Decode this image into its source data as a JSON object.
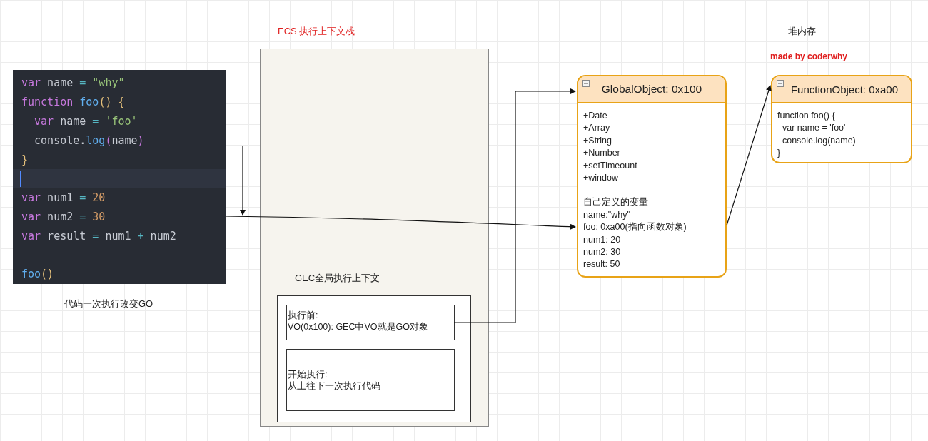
{
  "ecs_title": "ECS 执行上下文栈",
  "heap_title": "堆内存",
  "credit": "made by coderwhy",
  "code_editor": {
    "lines": [
      {
        "current": false,
        "tokens": [
          {
            "text": "var",
            "kind": "kw"
          },
          {
            "text": " name ",
            "kind": "id"
          },
          {
            "text": "=",
            "kind": "op"
          },
          {
            "text": " \"why\"",
            "kind": "str"
          }
        ]
      },
      {
        "current": false,
        "tokens": [
          {
            "text": "function",
            "kind": "kw"
          },
          {
            "text": " foo",
            "kind": "fn"
          },
          {
            "text": "()",
            "kind": "paren"
          },
          {
            "text": " {",
            "kind": "paren"
          }
        ]
      },
      {
        "current": false,
        "tokens": [
          {
            "text": "  var",
            "kind": "kw"
          },
          {
            "text": " name ",
            "kind": "id"
          },
          {
            "text": "=",
            "kind": "op"
          },
          {
            "text": " 'foo'",
            "kind": "str"
          }
        ]
      },
      {
        "current": false,
        "tokens": [
          {
            "text": "  console.",
            "kind": "id"
          },
          {
            "text": "log",
            "kind": "fn"
          },
          {
            "text": "(",
            "kind": "paren2"
          },
          {
            "text": "name",
            "kind": "id"
          },
          {
            "text": ")",
            "kind": "paren2"
          }
        ]
      },
      {
        "current": false,
        "tokens": [
          {
            "text": "}",
            "kind": "paren"
          }
        ]
      },
      {
        "current": true
      },
      {
        "current": false,
        "tokens": [
          {
            "text": "var",
            "kind": "kw"
          },
          {
            "text": " num1 ",
            "kind": "id"
          },
          {
            "text": "=",
            "kind": "op"
          },
          {
            "text": " 20",
            "kind": "num"
          }
        ]
      },
      {
        "current": false,
        "tokens": [
          {
            "text": "var",
            "kind": "kw"
          },
          {
            "text": " num2 ",
            "kind": "id"
          },
          {
            "text": "=",
            "kind": "op"
          },
          {
            "text": " 30",
            "kind": "num"
          }
        ]
      },
      {
        "current": false,
        "tokens": [
          {
            "text": "var",
            "kind": "kw"
          },
          {
            "text": " result ",
            "kind": "id"
          },
          {
            "text": "=",
            "kind": "op"
          },
          {
            "text": " num1 ",
            "kind": "id"
          },
          {
            "text": "+",
            "kind": "op"
          },
          {
            "text": " num2",
            "kind": "id"
          }
        ]
      },
      {
        "current": false,
        "tokens": [
          {
            "text": "foo",
            "kind": "fn"
          },
          {
            "text": "()",
            "kind": "paren"
          }
        ]
      }
    ]
  },
  "code_caption": "代码一次执行改变GO",
  "gec": {
    "title": "GEC全局执行上下文",
    "sections": [
      {
        "lines": [
          "执行前:",
          "VO(0x100): GEC中VO就是GO对象"
        ]
      },
      {
        "lines": [
          "开始执行:",
          "从上往下一次执行代码"
        ]
      }
    ]
  },
  "global_object": {
    "title": "GlobalObject: 0x100",
    "sections": [
      {
        "lines": [
          "+Date",
          "+Array",
          "+String",
          "+Number",
          "+setTimeount",
          "+window"
        ]
      },
      {
        "lines": [
          "自己定义的变量",
          "name:\"why\"",
          "foo: 0xa00(指向函数对象)",
          "num1: 20",
          "num2: 30",
          "result: 50"
        ]
      }
    ]
  },
  "function_object": {
    "title": "FunctionObject: 0xa00",
    "sections": [
      {
        "lines": [
          "function foo() {",
          "  var name = 'foo'",
          "  console.log(name)",
          "}"
        ]
      }
    ]
  }
}
